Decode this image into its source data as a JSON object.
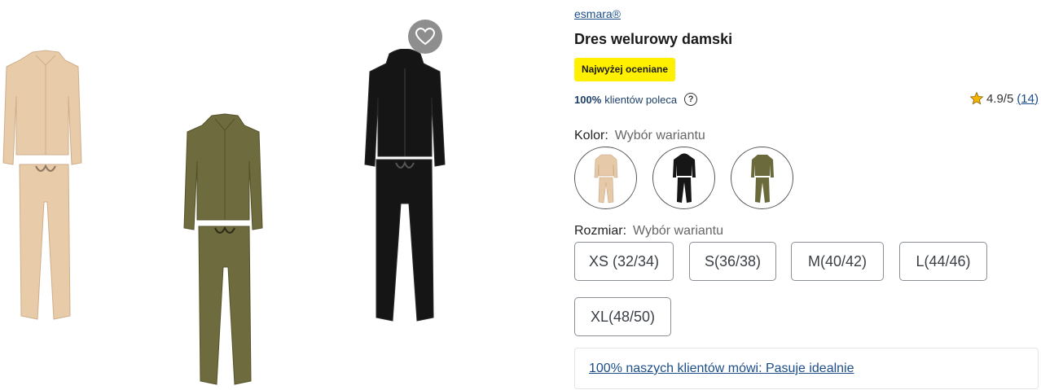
{
  "product": {
    "brand": "esmara®",
    "title": "Dres welurowy damski",
    "badge": "Najwyżej oceniane",
    "recommend_pct": "100%",
    "recommend_text": "klientów poleca",
    "help_glyph": "?",
    "rating": "4.9/5",
    "rating_count": "(14)"
  },
  "color": {
    "label": "Kolor:",
    "hint": "Wybór wariantu",
    "options": [
      {
        "name": "beige",
        "hex": "#e6c9a8"
      },
      {
        "name": "black",
        "hex": "#161616"
      },
      {
        "name": "olive",
        "hex": "#6b6a3d"
      }
    ]
  },
  "size": {
    "label": "Rozmiar:",
    "hint": "Wybór wariantu",
    "options": [
      "XS (32/34)",
      "S(36/38)",
      "M(40/42)",
      "L(44/46)",
      "XL(48/50)"
    ]
  },
  "fit": {
    "text": "100% naszych klientów mówi: Pasuje idealnie"
  },
  "icons": {
    "wishlist": "heart-icon",
    "rating": "star-icon",
    "help": "help-circle-icon"
  },
  "colors": {
    "accent": "#1d4e89",
    "badge": "#fff000",
    "star": "#f5b400"
  }
}
